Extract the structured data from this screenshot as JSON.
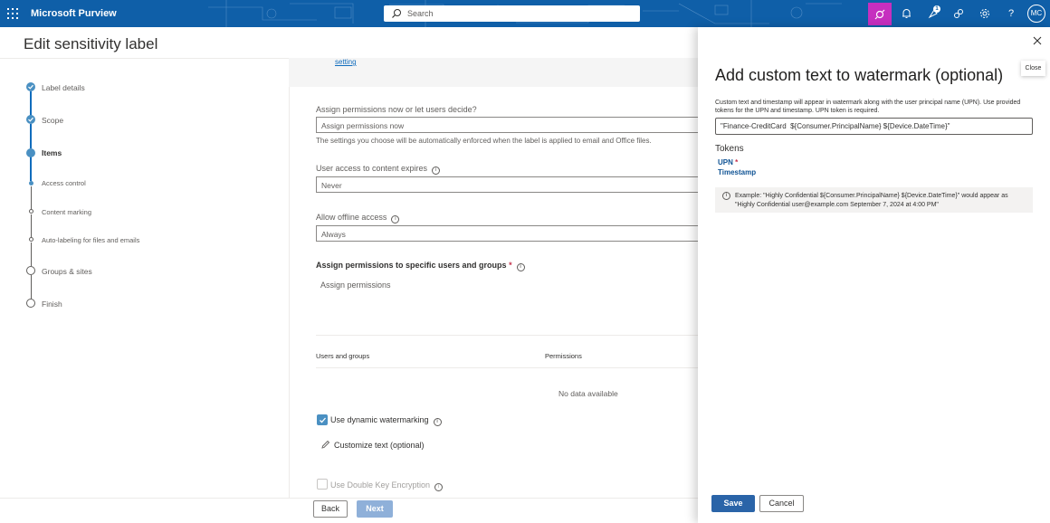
{
  "topbar": {
    "brand": "Microsoft Purview",
    "search_placeholder": "Search",
    "notification_count": "1",
    "avatar_initials": "MC",
    "colors": {
      "bar": "#0f5fa8",
      "copilot": "#c62fbf"
    }
  },
  "page": {
    "title": "Edit sensitivity label"
  },
  "stepper": {
    "steps": [
      {
        "label": "Label details",
        "state": "done"
      },
      {
        "label": "Scope",
        "state": "done"
      },
      {
        "label": "Items",
        "state": "current"
      },
      {
        "label": "Access control",
        "state": "current-sub"
      },
      {
        "label": "Content marking",
        "state": "sub"
      },
      {
        "label": "Auto-labeling for files and emails",
        "state": "sub"
      },
      {
        "label": "Groups & sites",
        "state": "pending"
      },
      {
        "label": "Finish",
        "state": "pending"
      }
    ]
  },
  "form": {
    "truncated_link": "setting",
    "assign_label": "Assign permissions now or let users decide?",
    "assign_value": "Assign permissions now",
    "assign_help": "The settings you choose will be automatically enforced when the label is applied to email and Office files.",
    "expire_label": "User access to content expires",
    "expire_value": "Never",
    "offline_label": "Allow offline access",
    "offline_value": "Always",
    "specific_label": "Assign permissions to specific users and groups",
    "required_mark": "*",
    "assign_link": "Assign permissions",
    "table_headers": [
      "Users and groups",
      "Permissions"
    ],
    "no_data": "No data available",
    "dynamic_watermark": "Use dynamic watermarking",
    "dynamic_checked": true,
    "customize_text": "Customize text (optional)",
    "double_key": "Use Double Key Encryption",
    "double_key_checked": false
  },
  "footer": {
    "back": "Back",
    "next": "Next"
  },
  "panel": {
    "close_tooltip": "Close",
    "title": "Add custom text to watermark (optional)",
    "description": "Custom text and timestamp will appear in watermark along with the user principal name (UPN). Use provided tokens for the UPN and timestamp. UPN token is required.",
    "input_value": "\"Finance-CreditCard  ${Consumer.PrincipalName} ${Device.DateTime}\"",
    "tokens_heading": "Tokens",
    "tokens": [
      {
        "label": "UPN",
        "required": "*"
      },
      {
        "label": "Timestamp",
        "required": ""
      }
    ],
    "example": "Example: \"Highly Confidential ${Consumer.PrincipalName} ${Device.DateTime}\" would appear as \"Highly Confidential user@example.com September 7, 2024 at 4:00 PM\"",
    "save": "Save",
    "cancel": "Cancel"
  }
}
